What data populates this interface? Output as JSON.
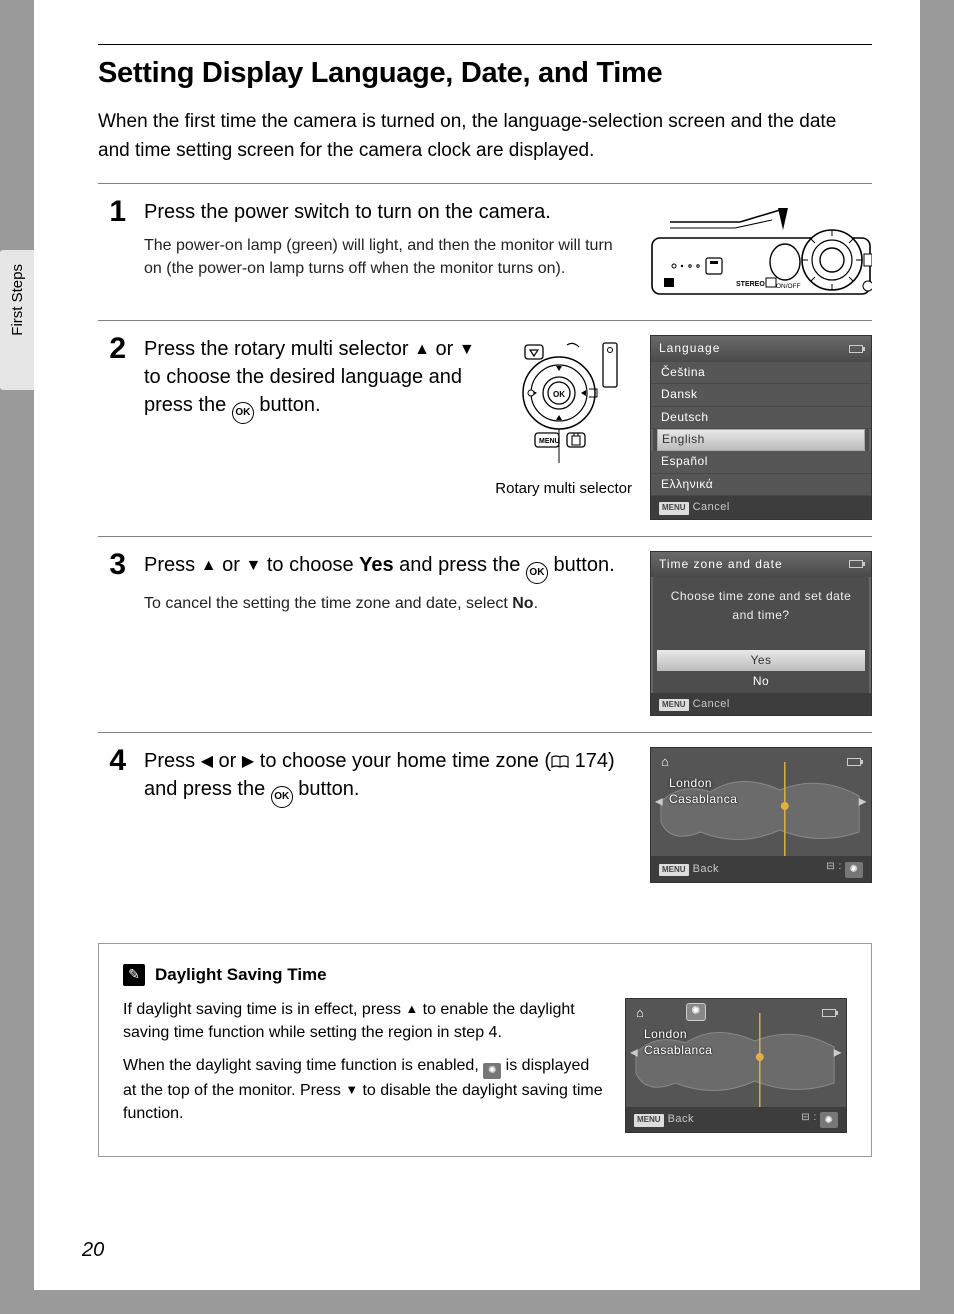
{
  "side_tab": "First Steps",
  "page_number": "20",
  "title": "Setting Display Language, Date, and Time",
  "intro": "When the first time the camera is turned on, the language-selection screen and the date and time setting screen for the camera clock are displayed.",
  "steps": {
    "s1": {
      "num": "1",
      "head": "Press the power switch to turn on the camera.",
      "sub": "The power-on lamp (green) will light, and then the monitor will turn on (the power-on lamp turns off when the monitor turns on)."
    },
    "s2": {
      "num": "2",
      "head_a": "Press the rotary multi selector ",
      "head_b": " or ",
      "head_c": " to choose the desired language and press the ",
      "head_d": " button.",
      "ill_label": "Rotary multi selector"
    },
    "s3": {
      "num": "3",
      "head_a": "Press ",
      "head_b": " or ",
      "head_c": " to choose ",
      "head_yes": "Yes",
      "head_d": " and press the ",
      "head_e": " button.",
      "sub_a": "To cancel the setting the time zone and date, select ",
      "sub_no": "No",
      "sub_b": "."
    },
    "s4": {
      "num": "4",
      "head_a": "Press ",
      "head_b": " or ",
      "head_c": " to choose your home time zone (",
      "head_ref": " 174) and press the ",
      "head_d": " button."
    }
  },
  "lcd_lang": {
    "title": "Language",
    "items": [
      "Čeština",
      "Dansk",
      "Deutsch",
      "English",
      "Español",
      "Ελληνικά"
    ],
    "selected_index": 3,
    "footer": "Cancel",
    "menu": "MENU"
  },
  "lcd_tz": {
    "title": "Time zone and date",
    "prompt": "Choose time zone and set date and time?",
    "yes": "Yes",
    "no": "No",
    "footer": "Cancel",
    "menu": "MENU"
  },
  "lcd_map": {
    "city1": "London",
    "city2": "Casablanca",
    "footer": "Back",
    "menu": "MENU"
  },
  "callout": {
    "title": "Daylight Saving Time",
    "p1_a": "If daylight saving time is in effect, press ",
    "p1_b": " to enable the daylight saving time function while setting the region in step 4.",
    "p2_a": "When the daylight saving time function is enabled, ",
    "p2_b": " is displayed at the top of the monitor. Press ",
    "p2_c": " to disable the daylight saving time function."
  },
  "icons": {
    "ok": "OK",
    "stereo": "STEREO",
    "onoff": "ON/OFF",
    "menu_small": "MENU"
  }
}
